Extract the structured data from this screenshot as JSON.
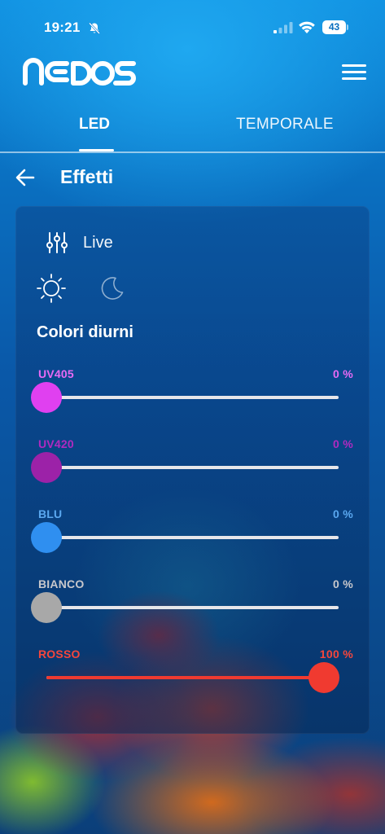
{
  "status_bar": {
    "time": "19:21",
    "battery": "43"
  },
  "header": {
    "logo": "NEDOS"
  },
  "tabs": [
    {
      "label": "LED",
      "active": true
    },
    {
      "label": "TEMPORALE",
      "active": false
    }
  ],
  "page": {
    "title": "Effetti",
    "mode_label": "Live",
    "section_title": "Colori diurni"
  },
  "colors": {
    "uv405": "#e040f0",
    "uv420": "#a020b0",
    "blu": "#2f8ff0",
    "bianco": "#a8a8a8",
    "rosso": "#f03a30"
  },
  "sliders": [
    {
      "label": "UV405",
      "value": "0 %",
      "level": 0,
      "color": "#e040f0",
      "label_color": "#e86af5"
    },
    {
      "label": "UV420",
      "value": "0 %",
      "level": 0,
      "color": "#9c22a8",
      "label_color": "#b02ac0"
    },
    {
      "label": "BLU",
      "value": "0 %",
      "level": 0,
      "color": "#2f8ff0",
      "label_color": "#5aa8f0"
    },
    {
      "label": "BIANCO",
      "value": "0 %",
      "level": 0,
      "color": "#a8a8a8",
      "label_color": "#c8c8cc"
    },
    {
      "label": "ROSSO",
      "value": "100 %",
      "level": 1,
      "color": "#f03a30",
      "label_color": "#f5463c"
    }
  ],
  "icons": [
    "bell-slash-icon",
    "signal-icon",
    "wifi-icon",
    "battery-icon",
    "menu-icon",
    "back-arrow-icon",
    "sliders-icon",
    "sun-icon",
    "moon-icon"
  ]
}
